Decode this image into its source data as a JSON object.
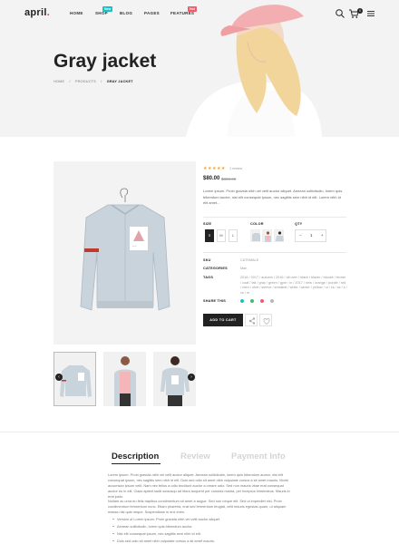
{
  "brand": {
    "name": "april",
    "dot": "."
  },
  "nav": {
    "items": [
      {
        "label": "HOME"
      },
      {
        "label": "SHOP",
        "badge": "New",
        "badge_color": "#17c1c9"
      },
      {
        "label": "BLOG"
      },
      {
        "label": "PAGES"
      },
      {
        "label": "FEATURES",
        "badge": "Hot",
        "badge_color": "#f45b69"
      }
    ],
    "icons": [
      "search-icon",
      "cart-icon",
      "menu-icon"
    ],
    "cart_count": "0"
  },
  "hero": {
    "title": "Gray jacket",
    "breadcrumb": [
      "HOME",
      "/",
      "PRODUCTS",
      "/",
      "GRAY JACKET"
    ]
  },
  "product": {
    "rating": "★★★★★",
    "reviews": "1 review",
    "price": "$80.00",
    "old_price": "$300.00",
    "description": "Lorem ipsum. Proin gravida nibh vel velit auctor aliquet. Aenean sollicitudin, lorem quis bibendum auctor, nisi elit consequat ipsum, nec sagittis sem nibh id elit. Lorem nibh id elit amet...",
    "size_label": "SIZE",
    "sizes": [
      "S",
      "M",
      "L"
    ],
    "selected_size": "S",
    "color_label": "COLOR",
    "qty_label": "QTY",
    "qty_minus": "−",
    "qty_value": "1",
    "qty_plus": "+",
    "sku_label": "SKU",
    "sku_value": "CATSMALE",
    "categories_label": "CATEGORIES",
    "categories_value": "Man",
    "tags_label": "TAGS",
    "tags_value": "2016 / 2017 / autumn / 2016 / all over / black / blazer / blouse / brown / coat / fall / gray / green / gym / in / 2017 / new / orange / purple / red / retro / shirt / sleeve / smallest / white / winter / yellow / ui / xs / xs / s / xs / m",
    "share_label": "SHARE THIS",
    "share_colors": [
      "#17c1c9",
      "#3dbf6a",
      "#f45b69",
      "#b7b7b7"
    ],
    "add_to_cart": "ADD TO CART",
    "action_icons": [
      "share-icon",
      "heart-icon"
    ]
  },
  "thumb_nav": {
    "prev": "‹",
    "next": "›"
  },
  "tabs": {
    "items": [
      "Description",
      "Review",
      "Payment Info"
    ],
    "active": "Description"
  },
  "description": {
    "para1": "Lorem ipsum. Proin gravida nibh vel velit auctor aliquet. Aenean sollicitudin, lorem quis bibendum auctor, nisi elit consequat ipsum, nec sagittis sem nibh id elit. Duis sed odio sit amet nibh vulputate cursus a sit amet mauris. Morbi accumsan ipsum velit. Nam nec tellus a odio tincidunt auctor a ornare odio. Sed non mauris vitae erat consequat auctor eu in elit. Class aptent taciti sociosqu ad litora torquent per conubia nostra, per inceptos himenaeos. Mauris in erat justo.",
    "para2": "Nullam ac urna eu felis dapibus condimentum sit amet a augue. Sed non neque elit. Sed ut imperdiet nisi. Proin condimentum fermentum nunc. Etiam pharetra, erat sed fermentum feugiat, velit mauris egestas quam, ut aliquam massa nisl quis neque. Suspendisse in orci enim.",
    "bullets": [
      "Version of Lorem ipsum. Proin gravida nibh vel velit auctor aliquet.",
      "Aenean sollicitudin, lorem quis bibendum auctor.",
      "Nisi elit consequat ipsum, nec sagittis sem nibh id elit.",
      "Duis sed odio sit amet nibh vulputate cursus a sit amet mauris."
    ]
  }
}
